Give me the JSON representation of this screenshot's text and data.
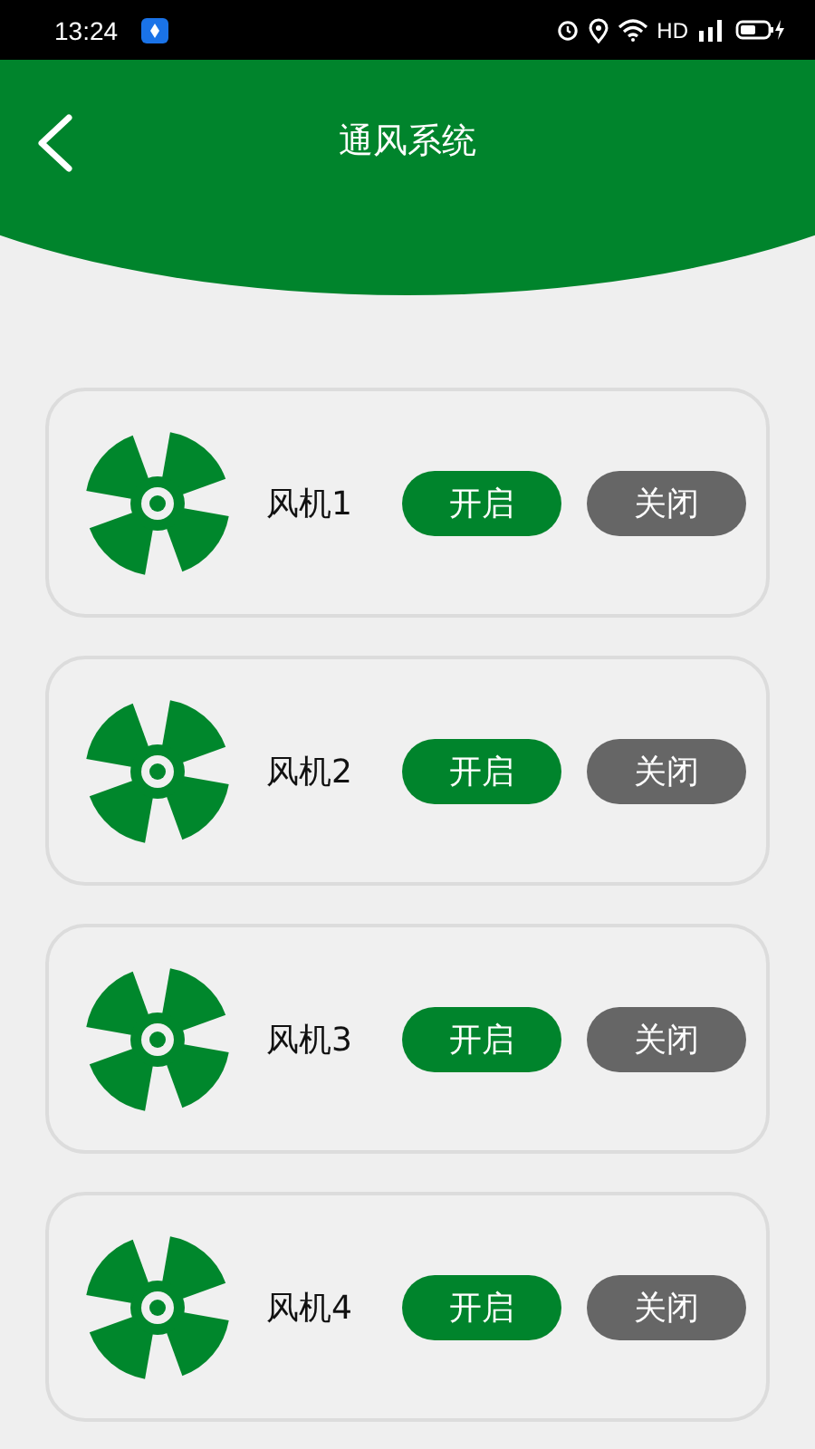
{
  "status_bar": {
    "time": "13:24",
    "network": "HD"
  },
  "header": {
    "title": "通风系统"
  },
  "fans": [
    {
      "name": "风机1",
      "open_label": "开启",
      "close_label": "关闭"
    },
    {
      "name": "风机2",
      "open_label": "开启",
      "close_label": "关闭"
    },
    {
      "name": "风机3",
      "open_label": "开启",
      "close_label": "关闭"
    },
    {
      "name": "风机4",
      "open_label": "开启",
      "close_label": "关闭"
    }
  ]
}
